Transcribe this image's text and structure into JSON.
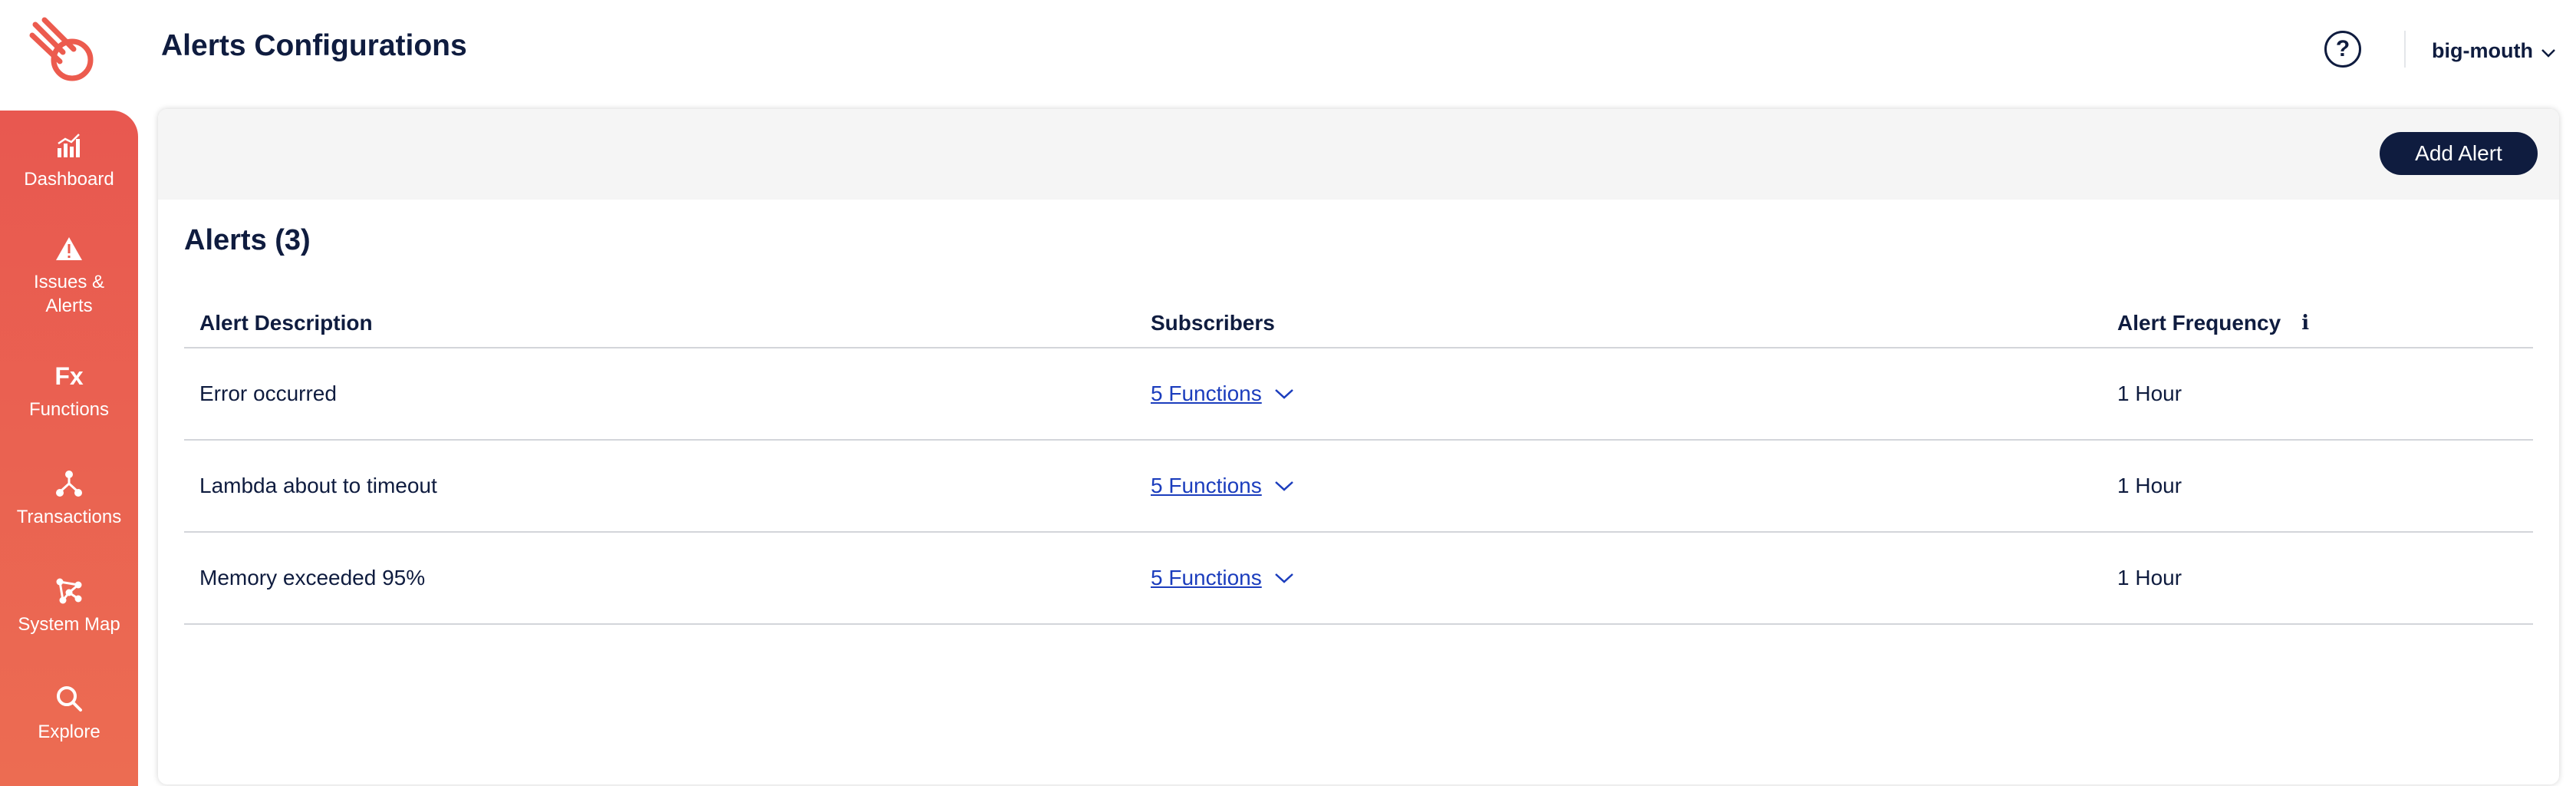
{
  "header": {
    "title": "Alerts Configurations",
    "help_icon": "question-circle-icon",
    "help_label": "?",
    "account_name": "big-mouth"
  },
  "sidebar": {
    "items": [
      {
        "label": "Dashboard",
        "icon": "bar-chart-icon"
      },
      {
        "label": "Issues &\nAlerts",
        "icon": "warning-triangle-icon"
      },
      {
        "label": "Functions",
        "icon": "fx-icon",
        "icon_text": "Fx"
      },
      {
        "label": "Transactions",
        "icon": "nodes-icon"
      },
      {
        "label": "System Map",
        "icon": "network-map-icon"
      },
      {
        "label": "Explore",
        "icon": "search-icon"
      }
    ]
  },
  "toolbar": {
    "add_label": "Add Alert"
  },
  "alerts": {
    "title": "Alerts (3)",
    "columns": [
      "Alert Description",
      "Subscribers",
      "Alert Frequency"
    ],
    "info_label": "i",
    "rows": [
      {
        "description": "Error occurred",
        "subscribers": "5 Functions",
        "frequency": "1 Hour"
      },
      {
        "description": "Lambda about to timeout",
        "subscribers": "5 Functions",
        "frequency": "1 Hour"
      },
      {
        "description": "Memory exceeded 95%",
        "subscribers": "5 Functions",
        "frequency": "1 Hour"
      }
    ]
  },
  "colors": {
    "brand": "#ec5b4e",
    "primary_dark": "#0f1c3f",
    "link": "#1b3dbd"
  }
}
